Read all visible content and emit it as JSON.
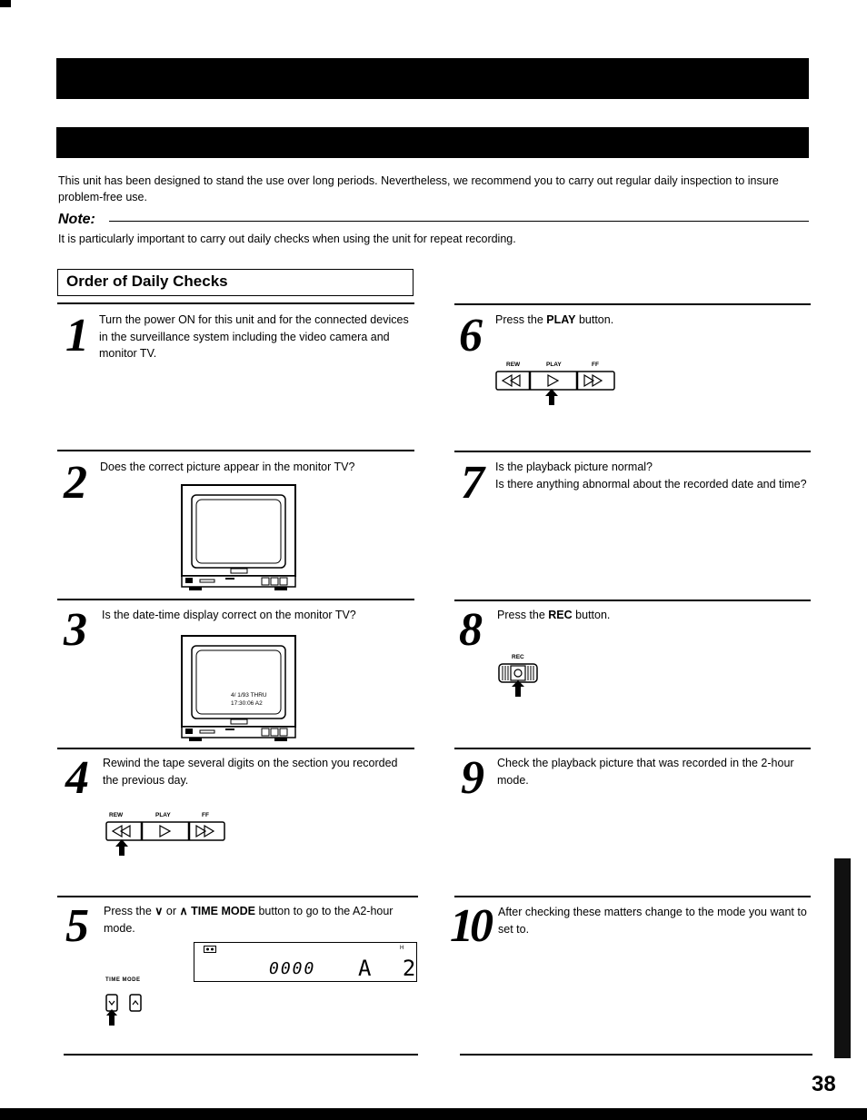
{
  "intro": "This unit has been designed to stand the use over long periods. Nevertheless, we recommend you to carry out regular daily inspection to insure problem-free use.",
  "note": {
    "label": "Note:",
    "text": "It is particularly important to carry out daily checks when using the unit for repeat recording."
  },
  "section_title": "Order of Daily Checks",
  "steps": [
    {
      "num": "1",
      "text": "Turn the power ON for this unit and for the connected devices in the surveillance system including the video camera and monitor TV."
    },
    {
      "num": "2",
      "text": "Does the correct picture appear in the monitor TV?"
    },
    {
      "num": "3",
      "text": "Is the date-time display correct on the monitor TV?",
      "screen_line1": "4/ 1/93 THRU",
      "screen_line2": "17:30:06 A2"
    },
    {
      "num": "4",
      "text": "Rewind the tape several digits on the section you recorded the previous day."
    },
    {
      "num": "5",
      "text_pre": "Press the ",
      "down": "∨",
      "or": " or ",
      "up": "∧",
      "bold": " TIME MODE",
      "text_post": " button to go to the A2-hour mode.",
      "display_counter": "0000",
      "display_mode": "A 2",
      "display_h": "H",
      "time_mode_label": "TIME MODE"
    },
    {
      "num": "6",
      "text_pre": "Press the ",
      "bold": "PLAY",
      "text_post": " button."
    },
    {
      "num": "7",
      "text_line1": "Is the playback picture normal?",
      "text_line2": "Is there anything abnormal about the recorded date and time?"
    },
    {
      "num": "8",
      "text_pre": "Press the ",
      "bold": "REC",
      "text_post": " button.",
      "rec_label": "REC"
    },
    {
      "num": "9",
      "text": "Check the playback picture that was recorded in the 2-hour mode."
    },
    {
      "num": "10",
      "text": "After checking these matters change to the mode you want to set to."
    }
  ],
  "transport": {
    "rew": "REW",
    "play": "PLAY",
    "ff": "FF"
  },
  "page_number": "38"
}
